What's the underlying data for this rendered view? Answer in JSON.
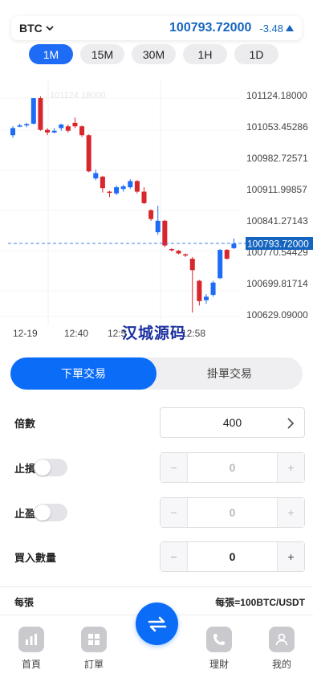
{
  "ticker": {
    "symbol": "BTC",
    "price": "100793.72000",
    "change": "-3.48",
    "change_direction": "up-triangle",
    "accent": "#1565c0"
  },
  "intervals": [
    {
      "label": "1M",
      "active": true
    },
    {
      "label": "15M",
      "active": false
    },
    {
      "label": "30M",
      "active": false
    },
    {
      "label": "1H",
      "active": false
    },
    {
      "label": "1D",
      "active": false
    }
  ],
  "chart_data": {
    "type": "candlestick",
    "y_ticks": [
      "101124.18000",
      "101053.45286",
      "100982.72571",
      "100911.99857",
      "100841.27143",
      "100770.54429",
      "100699.81714",
      "100629.09000"
    ],
    "x_ticks": [
      "12-19",
      "12:40",
      "12:5",
      "12:58"
    ],
    "ylim": [
      100629.09,
      101124.18
    ],
    "current_price_label": "100793.72000",
    "current_price": 100793.72,
    "faint_label": "101124.18000",
    "up_color": "#1e6cf5",
    "down_color": "#d7262c",
    "candles": [
      {
        "o": 101040,
        "c": 101056,
        "h": 101060,
        "l": 101034
      },
      {
        "o": 101062,
        "c": 101062,
        "h": 101066,
        "l": 101058
      },
      {
        "o": 101062,
        "c": 101065,
        "h": 101068,
        "l": 101058
      },
      {
        "o": 101066,
        "c": 101124,
        "h": 101124,
        "l": 101064
      },
      {
        "o": 101124,
        "c": 101052,
        "h": 101128,
        "l": 101050
      },
      {
        "o": 101052,
        "c": 101046,
        "h": 101056,
        "l": 101040
      },
      {
        "o": 101046,
        "c": 101050,
        "h": 101056,
        "l": 101044
      },
      {
        "o": 101056,
        "c": 101064,
        "h": 101066,
        "l": 101050
      },
      {
        "o": 101060,
        "c": 101050,
        "h": 101064,
        "l": 101046
      },
      {
        "o": 101068,
        "c": 101060,
        "h": 101080,
        "l": 101056
      },
      {
        "o": 101060,
        "c": 101040,
        "h": 101062,
        "l": 101036
      },
      {
        "o": 101040,
        "c": 100958,
        "h": 101042,
        "l": 100956
      },
      {
        "o": 100942,
        "c": 100954,
        "h": 100962,
        "l": 100938
      },
      {
        "o": 100946,
        "c": 100920,
        "h": 100948,
        "l": 100910
      },
      {
        "o": 100912,
        "c": 100910,
        "h": 100914,
        "l": 100900
      },
      {
        "o": 100908,
        "c": 100922,
        "h": 100926,
        "l": 100904
      },
      {
        "o": 100918,
        "c": 100924,
        "h": 100928,
        "l": 100912
      },
      {
        "o": 100922,
        "c": 100936,
        "h": 100940,
        "l": 100918
      },
      {
        "o": 100936,
        "c": 100912,
        "h": 100938,
        "l": 100908
      },
      {
        "o": 100912,
        "c": 100886,
        "h": 100922,
        "l": 100884
      },
      {
        "o": 100870,
        "c": 100850,
        "h": 100872,
        "l": 100846
      },
      {
        "o": 100820,
        "c": 100846,
        "h": 100880,
        "l": 100814
      },
      {
        "o": 100846,
        "c": 100790,
        "h": 100848,
        "l": 100786
      },
      {
        "o": 100782,
        "c": 100780,
        "h": 100784,
        "l": 100776
      },
      {
        "o": 100778,
        "c": 100772,
        "h": 100780,
        "l": 100770
      },
      {
        "o": 100770,
        "c": 100768,
        "h": 100772,
        "l": 100764
      },
      {
        "o": 100760,
        "c": 100734,
        "h": 100764,
        "l": 100638
      },
      {
        "o": 100710,
        "c": 100664,
        "h": 100712,
        "l": 100654
      },
      {
        "o": 100666,
        "c": 100674,
        "h": 100680,
        "l": 100658
      },
      {
        "o": 100678,
        "c": 100706,
        "h": 100710,
        "l": 100674
      },
      {
        "o": 100716,
        "c": 100780,
        "h": 100782,
        "l": 100714
      },
      {
        "o": 100780,
        "c": 100760,
        "h": 100782,
        "l": 100758
      },
      {
        "o": 100784,
        "c": 100794,
        "h": 100806,
        "l": 100782
      }
    ]
  },
  "watermark": "汉城源码",
  "order_tabs": [
    "下單交易",
    "掛單交易"
  ],
  "form": {
    "leverage_label": "倍數",
    "leverage_value": "400",
    "stop_loss_label": "止損",
    "stop_loss_value": "0",
    "take_profit_label": "止盈",
    "take_profit_value": "0",
    "quantity_label": "買入數量",
    "quantity_value": "0",
    "minus": "−",
    "plus": "+",
    "per_label": "每張",
    "per_value": "每張=100BTC/USDT"
  },
  "nav": [
    {
      "label": "首頁",
      "icon": "chart-icon"
    },
    {
      "label": "訂單",
      "icon": "grid-icon"
    },
    {
      "label": "理財",
      "icon": "phone-icon"
    },
    {
      "label": "我的",
      "icon": "user-icon"
    }
  ]
}
